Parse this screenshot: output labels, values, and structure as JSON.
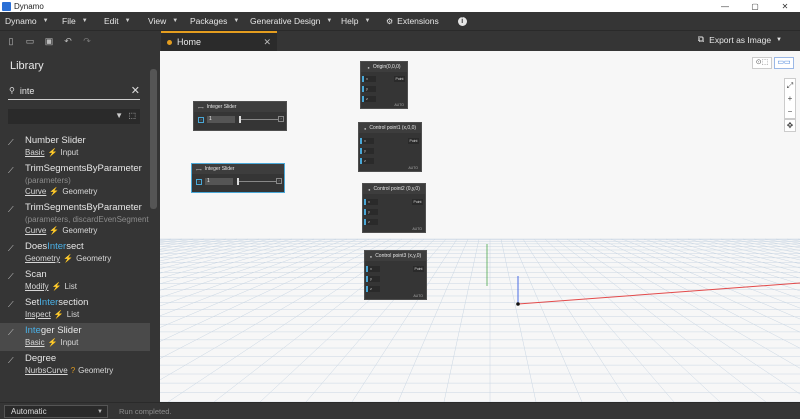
{
  "window": {
    "title": "Dynamo",
    "icons": [
      "minimize-icon",
      "maximize-icon",
      "close-icon"
    ]
  },
  "menu": {
    "items": [
      {
        "label": "Dynamo"
      },
      {
        "label": "File"
      },
      {
        "label": "Edit"
      },
      {
        "label": "View"
      },
      {
        "label": "Packages"
      },
      {
        "label": "Generative Design"
      },
      {
        "label": "Help"
      }
    ],
    "extensions": "Extensions"
  },
  "tab": {
    "label": "Home"
  },
  "export": {
    "label": "Export as Image"
  },
  "library": {
    "title": "Library",
    "search": {
      "value": "inte"
    },
    "items": [
      {
        "name_pre": "Number Slider",
        "name_hl": "",
        "name_post": "",
        "params": "",
        "category": "Basic",
        "type_icon": "action-icon",
        "group": "Input",
        "selected": false
      },
      {
        "name_pre": "TrimSegmentsByParameter",
        "name_hl": "",
        "name_post": "",
        "params": "(parameters)",
        "category": "Curve",
        "type_icon": "action-icon",
        "group": "Geometry",
        "selected": false
      },
      {
        "name_pre": "TrimSegmentsByParameter",
        "name_hl": "",
        "name_post": "",
        "params": "(parameters, discardEvenSegment",
        "category": "Curve",
        "type_icon": "action-icon",
        "group": "Geometry",
        "selected": false
      },
      {
        "name_pre": "Does",
        "name_hl": "Inter",
        "name_post": "sect",
        "params": "",
        "category": "Geometry",
        "type_icon": "action-icon",
        "group": "Geometry",
        "selected": false
      },
      {
        "name_pre": "Scan",
        "name_hl": "",
        "name_post": "",
        "params": "",
        "category": "Modify",
        "type_icon": "action-icon",
        "group": "List",
        "selected": false
      },
      {
        "name_pre": "Set",
        "name_hl": "Inter",
        "name_post": "section",
        "params": "",
        "category": "Inspect",
        "type_icon": "action-icon",
        "group": "List",
        "selected": false
      },
      {
        "name_pre": "",
        "name_hl": "Inte",
        "name_post": "ger Slider",
        "params": "",
        "category": "Basic",
        "type_icon": "action-icon",
        "group": "Input",
        "selected": true
      },
      {
        "name_pre": "Degree",
        "name_hl": "",
        "name_post": "",
        "params": "",
        "category": "NurbsCurve",
        "type_icon": "query-icon",
        "group": "Geometry",
        "selected": false
      }
    ]
  },
  "nodes": [
    {
      "title": "Origin(0,0,0)",
      "ports": [
        "x",
        "y",
        "z"
      ],
      "output": "Point",
      "lacing": "AUTO"
    },
    {
      "title": "Control point1 (x,0,0)",
      "ports": [
        "x",
        "y",
        "z"
      ],
      "output": "Point",
      "lacing": "AUTO"
    },
    {
      "title": "Control point2 (0,y,0)",
      "ports": [
        "x",
        "y",
        "z"
      ],
      "output": "Point",
      "lacing": "AUTO"
    },
    {
      "title": "Control point3 (x,y,0)",
      "ports": [
        "x",
        "y",
        "z"
      ],
      "output": "Point",
      "lacing": "AUTO"
    }
  ],
  "sliders": [
    {
      "title": "Integer Slider",
      "value": "1"
    },
    {
      "title": "Integer Slider",
      "value": "1"
    }
  ],
  "status": {
    "run_mode": "Automatic",
    "message": "Run completed."
  }
}
